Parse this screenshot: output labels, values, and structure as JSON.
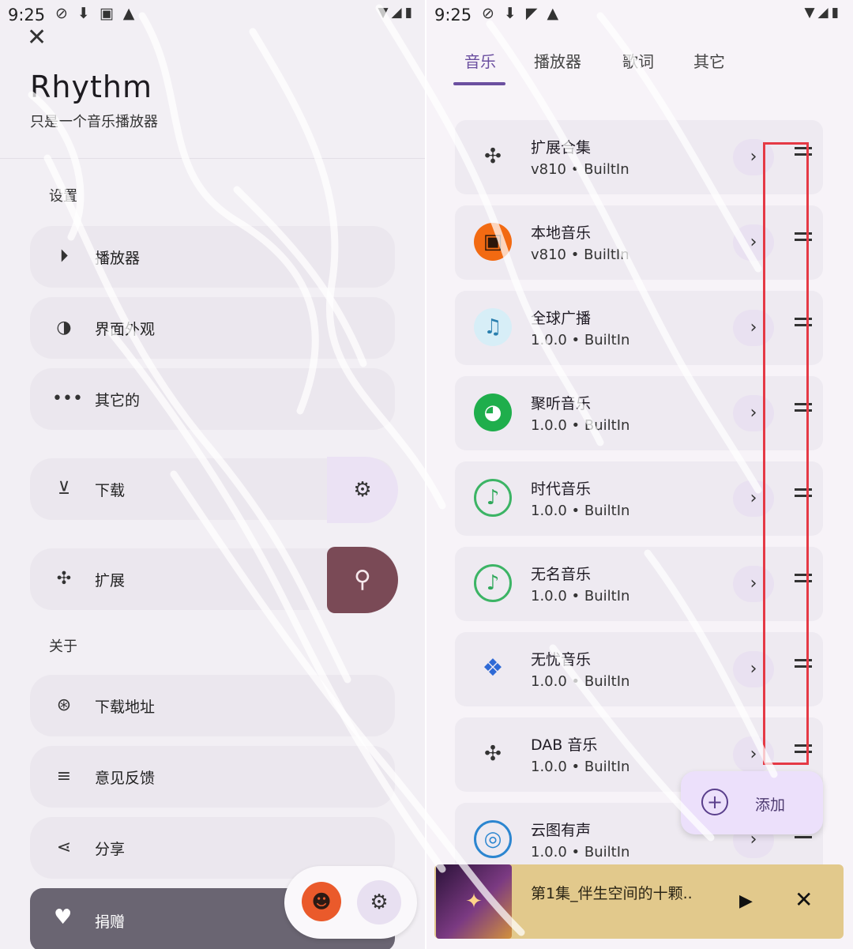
{
  "status": {
    "time": "9:25"
  },
  "left": {
    "app_title": "Rhythm",
    "app_subtitle": "只是一个音乐播放器",
    "section_settings": "设置",
    "items": [
      {
        "label": "播放器",
        "icon": "play-circle-icon"
      },
      {
        "label": "界面外观",
        "icon": "palette-icon"
      },
      {
        "label": "其它的",
        "icon": "more-horizontal-icon"
      },
      {
        "label": "下载",
        "icon": "download-circle-icon"
      },
      {
        "label": "扩展",
        "icon": "puzzle-icon"
      }
    ],
    "section_about": "关于",
    "about_items": [
      {
        "label": "下载地址",
        "icon": "download-address-icon"
      },
      {
        "label": "意见反馈",
        "icon": "feedback-edit-icon"
      },
      {
        "label": "分享",
        "icon": "share-icon"
      }
    ],
    "donate_label": "捐赠"
  },
  "right": {
    "tabs": [
      "音乐",
      "播放器",
      "歌词",
      "其它"
    ],
    "active_tab": "音乐",
    "extensions": [
      {
        "name": "扩展合集",
        "version": "v810",
        "type": "BuiltIn"
      },
      {
        "name": "本地音乐",
        "version": "v810",
        "type": "BuiltIn"
      },
      {
        "name": "全球广播",
        "version": "1.0.0",
        "type": "BuiltIn"
      },
      {
        "name": "聚听音乐",
        "version": "1.0.0",
        "type": "BuiltIn"
      },
      {
        "name": "时代音乐",
        "version": "1.0.0",
        "type": "BuiltIn"
      },
      {
        "name": "无名音乐",
        "version": "1.0.0",
        "type": "BuiltIn"
      },
      {
        "name": "无忧音乐",
        "version": "1.0.0",
        "type": "BuiltIn"
      },
      {
        "name": "DAB 音乐",
        "version": "1.0.0",
        "type": "BuiltIn"
      },
      {
        "name": "云图有声",
        "version": "1.0.0",
        "type": "BuiltIn"
      }
    ],
    "separator": " • ",
    "add_label": "添加",
    "now_playing": "第1集_伴生空间的十颗.."
  },
  "colors": {
    "accent": "#6b4fa0",
    "highlight": "#e53945",
    "player_bg": "#e2c98c"
  }
}
